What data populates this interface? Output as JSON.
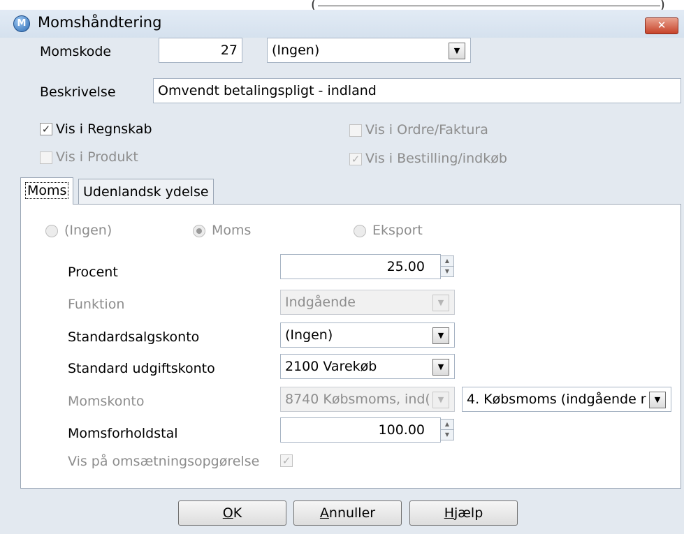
{
  "window": {
    "title": "Momshåndtering",
    "close_glyph": "✕",
    "app_icon_glyph": "M"
  },
  "header": {
    "momskode_label": "Momskode",
    "momskode_value": "27",
    "momskode_select": "(Ingen)",
    "beskrivelse_label": "Beskrivelse",
    "beskrivelse_value": "Omvendt betalingspligt - indland"
  },
  "checkboxes": {
    "regnskab": {
      "label": "Vis i Regnskab",
      "checked": true
    },
    "produkt": {
      "label": "Vis i Produkt",
      "checked": false
    },
    "ordre": {
      "label": "Vis i Ordre/Faktura",
      "checked": false
    },
    "bestilling": {
      "label": "Vis i Bestilling/indkøb",
      "checked": true
    }
  },
  "tabs": [
    {
      "label": "Moms",
      "active": true
    },
    {
      "label": "Udenlandsk ydelse",
      "active": false
    }
  ],
  "radios": [
    {
      "label": "(Ingen)",
      "selected": false
    },
    {
      "label": "Moms",
      "selected": true
    },
    {
      "label": "Eksport",
      "selected": false
    }
  ],
  "form": {
    "procent_label": "Procent",
    "procent_value": "25.00",
    "funktion_label": "Funktion",
    "funktion_value": "Indgående",
    "salgskonto_label": "Standardsalgskonto",
    "salgskonto_value": "(Ingen)",
    "udgiftskonto_label": "Standard udgiftskonto",
    "udgiftskonto_value": "2100 Varekøb",
    "momskonto_label": "Momskonto",
    "momskonto_value": "8740 Købsmoms, ind(",
    "momskonto_type_value": "4. Købsmoms (indgående r",
    "momsforholdstal_label": "Momsforholdstal",
    "momsforholdstal_value": "100.00",
    "omsaetning_label": "Vis på omsætningsopgørelse",
    "omsaetning_checked": true
  },
  "buttons": {
    "ok": {
      "accel": "O",
      "rest": "K"
    },
    "annuller": {
      "accel": "A",
      "rest": "nnuller"
    },
    "hjaelp": {
      "accel": "H",
      "rest": "jælp"
    }
  },
  "icons": {
    "check": "✓",
    "dropdown": "▼",
    "spin_up": "▲",
    "spin_down": "▼"
  }
}
